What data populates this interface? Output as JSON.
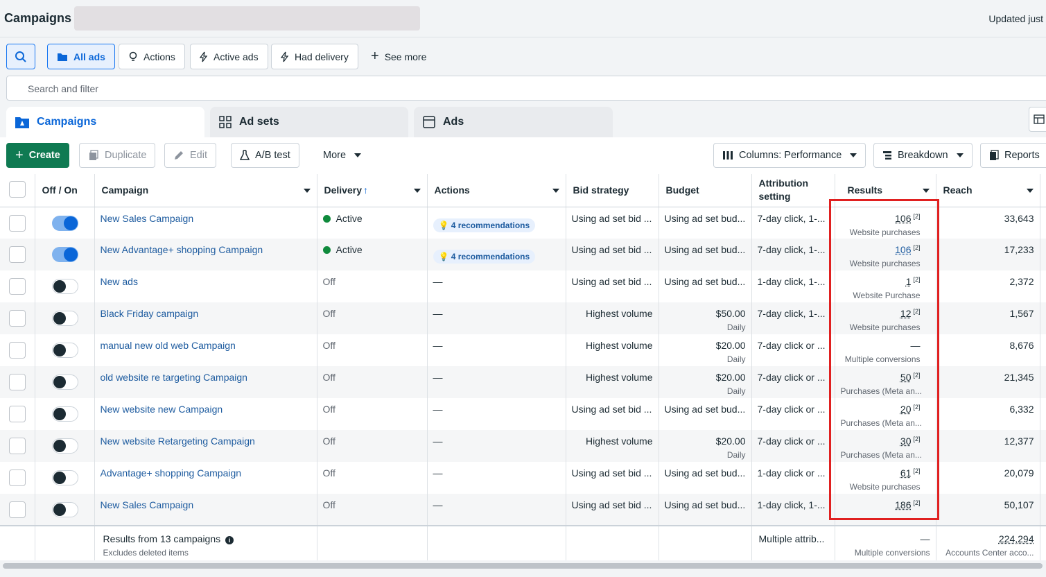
{
  "topbar": {
    "title": "Campaigns",
    "updated": "Updated just"
  },
  "filters": {
    "all_ads": "All ads",
    "actions": "Actions",
    "active_ads": "Active ads",
    "had_delivery": "Had delivery",
    "see_more": "See more",
    "search_placeholder": "Search and filter"
  },
  "tabs": {
    "campaigns": "Campaigns",
    "ad_sets": "Ad sets",
    "ads": "Ads"
  },
  "toolbar": {
    "create": "Create",
    "duplicate": "Duplicate",
    "edit": "Edit",
    "ab_test": "A/B test",
    "more": "More",
    "columns": "Columns: Performance",
    "breakdown": "Breakdown",
    "reports": "Reports"
  },
  "columns": {
    "off_on": "Off / On",
    "campaign": "Campaign",
    "delivery": "Delivery",
    "actions": "Actions",
    "bid_strategy": "Bid strategy",
    "budget": "Budget",
    "attribution": "Attribution setting",
    "results": "Results",
    "reach": "Reach"
  },
  "rows": [
    {
      "name": "New Sales Campaign",
      "on": true,
      "delivery": "Active",
      "actions": "4 recommendations",
      "bid": "Using ad set bid ...",
      "budget": "Using ad set bud...",
      "budget_sub": "",
      "attr": "7-day click, 1-...",
      "result": "106",
      "result_sub": "Website purchases",
      "reach": "33,643"
    },
    {
      "name": "New Advantage+ shopping Campaign",
      "on": true,
      "delivery": "Active",
      "actions": "4 recommendations",
      "bid": "Using ad set bid ...",
      "budget": "Using ad set bud...",
      "budget_sub": "",
      "attr": "7-day click, 1-...",
      "result": "106",
      "result_sub": "Website purchases",
      "reach": "17,233"
    },
    {
      "name": "New ads",
      "on": false,
      "delivery": "Off",
      "actions": "—",
      "bid": "Using ad set bid ...",
      "budget": "Using ad set bud...",
      "budget_sub": "",
      "attr": "1-day click, 1-...",
      "result": "1",
      "result_sub": "Website Purchase",
      "reach": "2,372"
    },
    {
      "name": "Black Friday campaign",
      "on": false,
      "delivery": "Off",
      "actions": "—",
      "bid": "Highest volume",
      "budget": "$50.00",
      "budget_sub": "Daily",
      "attr": "7-day click, 1-...",
      "result": "12",
      "result_sub": "Website purchases",
      "reach": "1,567"
    },
    {
      "name": "manual new old web Campaign",
      "on": false,
      "delivery": "Off",
      "actions": "—",
      "bid": "Highest volume",
      "budget": "$20.00",
      "budget_sub": "Daily",
      "attr": "7-day click or ...",
      "result": "—",
      "result_sub": "Multiple conversions",
      "reach": "8,676"
    },
    {
      "name": "old website re targeting Campaign",
      "on": false,
      "delivery": "Off",
      "actions": "—",
      "bid": "Highest volume",
      "budget": "$20.00",
      "budget_sub": "Daily",
      "attr": "7-day click or ...",
      "result": "50",
      "result_sub": "Purchases (Meta an...",
      "reach": "21,345"
    },
    {
      "name": "New website new Campaign",
      "on": false,
      "delivery": "Off",
      "actions": "—",
      "bid": "Using ad set bid ...",
      "budget": "Using ad set bud...",
      "budget_sub": "",
      "attr": "7-day click or ...",
      "result": "20",
      "result_sub": "Purchases (Meta an...",
      "reach": "6,332"
    },
    {
      "name": "New website Retargeting Campaign",
      "on": false,
      "delivery": "Off",
      "actions": "—",
      "bid": "Highest volume",
      "budget": "$20.00",
      "budget_sub": "Daily",
      "attr": "7-day click or ...",
      "result": "30",
      "result_sub": "Purchases (Meta an...",
      "reach": "12,377"
    },
    {
      "name": "Advantage+ shopping Campaign",
      "on": false,
      "delivery": "Off",
      "actions": "—",
      "bid": "Using ad set bid ...",
      "budget": "Using ad set bud...",
      "budget_sub": "",
      "attr": "1-day click or ...",
      "result": "61",
      "result_sub": "Website purchases",
      "reach": "20,079"
    },
    {
      "name": "New Sales Campaign",
      "on": false,
      "delivery": "Off",
      "actions": "—",
      "bid": "Using ad set bid ...",
      "budget": "Using ad set bud...",
      "budget_sub": "",
      "attr": "1-day click, 1-...",
      "result": "186",
      "result_sub": "",
      "reach": "50,107"
    }
  ],
  "footer": {
    "results_from": "Results from 13 campaigns",
    "excludes": "Excludes deleted items",
    "attr": "Multiple attrib...",
    "result": "—",
    "result_sub": "Multiple conversions",
    "reach": "224,294",
    "reach_sub": "Accounts Center acco..."
  }
}
